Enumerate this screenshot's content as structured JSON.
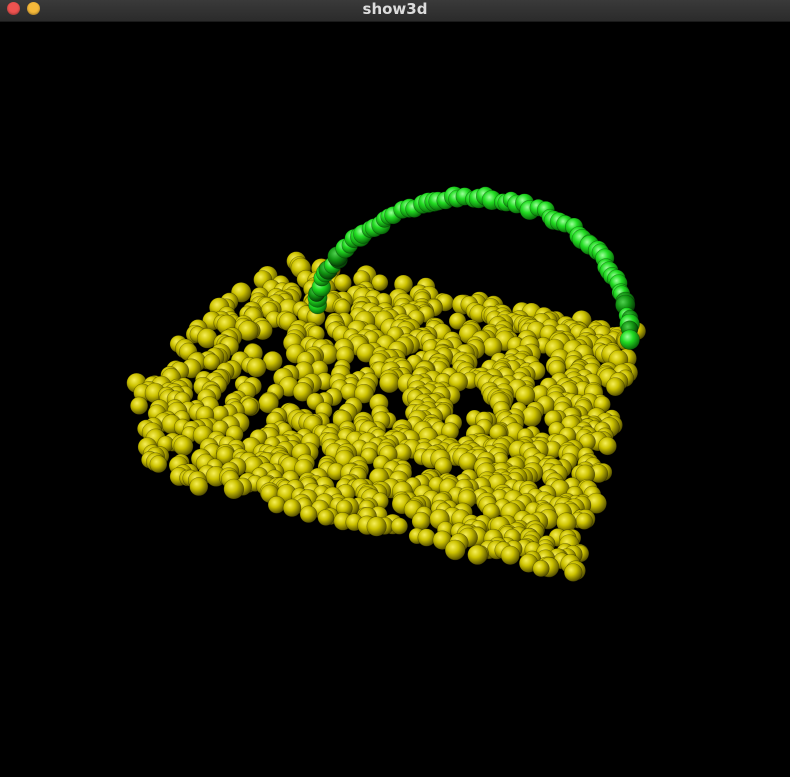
{
  "window": {
    "title": "show3d",
    "controls": [
      {
        "name": "close-button",
        "icon": "close-icon",
        "color": "#ee5350"
      },
      {
        "name": "minimize-button",
        "icon": "minimize-icon",
        "color": "#f5b93a"
      }
    ]
  },
  "viewport": {
    "background": "#000000",
    "point_colors": {
      "body": "#c8c000",
      "handle": "#22dd22"
    }
  }
}
